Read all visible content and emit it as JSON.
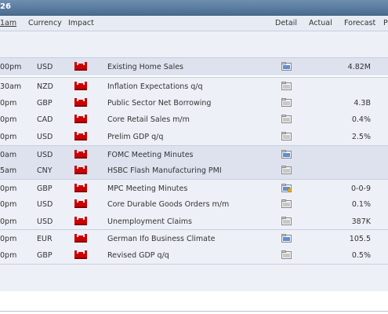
{
  "topbar": {
    "title": "26"
  },
  "header": {
    "time": "1am",
    "currency": "Currency",
    "impact": "Impact",
    "detail": "Detail",
    "actual": "Actual",
    "forecast": "Forecast",
    "previous": "P"
  },
  "colors": {
    "impact_high": "#cc0000",
    "row_highlight": "#dde2ee",
    "row_normal": "#eef0f7",
    "header_bar": "#4a6c90"
  },
  "rows": [
    {
      "time": "00pm",
      "currency": "USD",
      "impact": "high-impact-icon",
      "event": "Existing Home Sales",
      "detail": "detail-blue-icon",
      "forecast": "4.82M"
    },
    {
      "time": "30am",
      "currency": "NZD",
      "impact": "high-impact-icon",
      "event": "Inflation Expectations q/q",
      "detail": "detail-gray-icon",
      "forecast": ""
    },
    {
      "time": "0pm",
      "currency": "GBP",
      "impact": "high-impact-icon",
      "event": "Public Sector Net Borrowing",
      "detail": "detail-gray-icon",
      "forecast": "4.3B"
    },
    {
      "time": "0pm",
      "currency": "CAD",
      "impact": "high-impact-icon",
      "event": "Core Retail Sales m/m",
      "detail": "detail-gray-icon",
      "forecast": "0.4%"
    },
    {
      "time": "0pm",
      "currency": "USD",
      "impact": "high-impact-icon",
      "event": "Prelim GDP q/q",
      "detail": "detail-gray-icon",
      "forecast": "2.5%"
    },
    {
      "time": "0am",
      "currency": "USD",
      "impact": "high-impact-icon",
      "event": "FOMC Meeting Minutes",
      "detail": "detail-blue-icon",
      "forecast": ""
    },
    {
      "time": "5am",
      "currency": "CNY",
      "impact": "high-impact-icon",
      "event": "HSBC Flash Manufacturing PMI",
      "detail": "detail-gray-icon",
      "forecast": ""
    },
    {
      "time": "0pm",
      "currency": "GBP",
      "impact": "high-impact-icon",
      "event": "MPC Meeting Minutes",
      "detail": "detail-star-icon",
      "forecast": "0-0-9"
    },
    {
      "time": "0pm",
      "currency": "USD",
      "impact": "high-impact-icon",
      "event": "Core Durable Goods Orders m/m",
      "detail": "detail-gray-icon",
      "forecast": "0.1%"
    },
    {
      "time": "0pm",
      "currency": "USD",
      "impact": "high-impact-icon",
      "event": "Unemployment Claims",
      "detail": "detail-gray-icon",
      "forecast": "387K"
    },
    {
      "time": "0pm",
      "currency": "EUR",
      "impact": "high-impact-icon",
      "event": "German Ifo Business Climate",
      "detail": "detail-blue-icon",
      "forecast": "105.5"
    },
    {
      "time": "0pm",
      "currency": "GBP",
      "impact": "high-impact-icon",
      "event": "Revised GDP q/q",
      "detail": "detail-gray-icon",
      "forecast": "0.5%"
    }
  ]
}
